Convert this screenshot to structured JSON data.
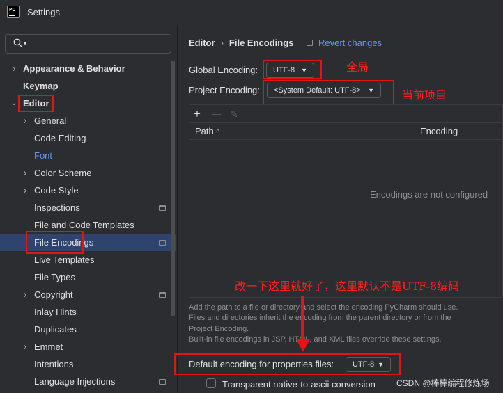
{
  "window": {
    "title": "Settings",
    "app_icon": "pycharm-logo"
  },
  "search": {
    "placeholder": ""
  },
  "sidebar": {
    "items": [
      {
        "label": "Appearance & Behavior",
        "expandable": true
      },
      {
        "label": "Keymap"
      },
      {
        "label": "Editor",
        "expanded": true
      },
      {
        "label": "General",
        "expandable": true
      },
      {
        "label": "Code Editing"
      },
      {
        "label": "Font"
      },
      {
        "label": "Color Scheme",
        "expandable": true
      },
      {
        "label": "Code Style",
        "expandable": true
      },
      {
        "label": "Inspections",
        "project_icon": true
      },
      {
        "label": "File and Code Templates"
      },
      {
        "label": "File Encodings",
        "selected": true,
        "project_icon": true
      },
      {
        "label": "Live Templates"
      },
      {
        "label": "File Types"
      },
      {
        "label": "Copyright",
        "expandable": true,
        "project_icon": true
      },
      {
        "label": "Inlay Hints"
      },
      {
        "label": "Duplicates"
      },
      {
        "label": "Emmet",
        "expandable": true
      },
      {
        "label": "Intentions"
      },
      {
        "label": "Language Injections",
        "project_icon": true
      }
    ]
  },
  "breadcrumb": {
    "parent": "Editor",
    "separator": "›",
    "current": "File Encodings"
  },
  "revert": {
    "label": "Revert changes"
  },
  "global_encoding": {
    "label": "Global Encoding:",
    "value": "UTF-8"
  },
  "project_encoding": {
    "label": "Project Encoding:",
    "value": "<System Default: UTF-8>"
  },
  "table": {
    "columns": [
      "Path",
      "Encoding"
    ],
    "sort_indicator": "^",
    "empty_text": "Encodings are not configured",
    "toolbar": {
      "add": "+",
      "remove": "—",
      "edit": "✎"
    }
  },
  "help_text": [
    "Add the path to a file or directory and select the encoding PyCharm should use.",
    "Files and directories inherit the encoding from the parent directory or from the",
    "Project Encoding.",
    "Built-in file encodings in JSP, HTML, and XML files override these settings."
  ],
  "properties": {
    "label": "Default encoding for properties files:",
    "value": "UTF-8"
  },
  "native_to_ascii": {
    "label": "Transparent native-to-ascii conversion",
    "checked": false
  },
  "annotations": {
    "global": "全局",
    "project": "当前项目",
    "note": "改一下这里就好了，这里默认不是UTF-8编码"
  },
  "watermark": "CSDN @棒棒编程修炼场",
  "colors": {
    "accent": "#5d9cf0",
    "selection": "#2e436e",
    "annotation_red": "#e51414"
  }
}
